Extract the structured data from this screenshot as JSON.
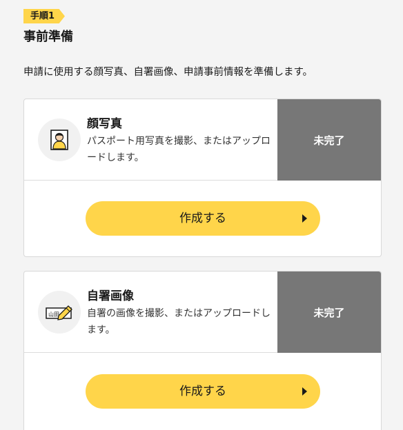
{
  "step": {
    "badge": "手順1",
    "title": "事前準備",
    "intro": "申請に使用する顔写真、自署画像、申請事前情報を準備します。"
  },
  "cards": [
    {
      "title": "顔写真",
      "description": "パスポート用写真を撮影、またはアップロードします。",
      "status": "未完了",
      "button_label": "作成する",
      "icon": "face-photo-icon"
    },
    {
      "title": "自署画像",
      "description": "自署の画像を撮影、またはアップロードします。",
      "status": "未完了",
      "button_label": "作成する",
      "icon": "signature-icon"
    }
  ],
  "colors": {
    "accent": "#ffd54a",
    "status_bg": "#777777",
    "page_bg": "#f4f4f4"
  }
}
